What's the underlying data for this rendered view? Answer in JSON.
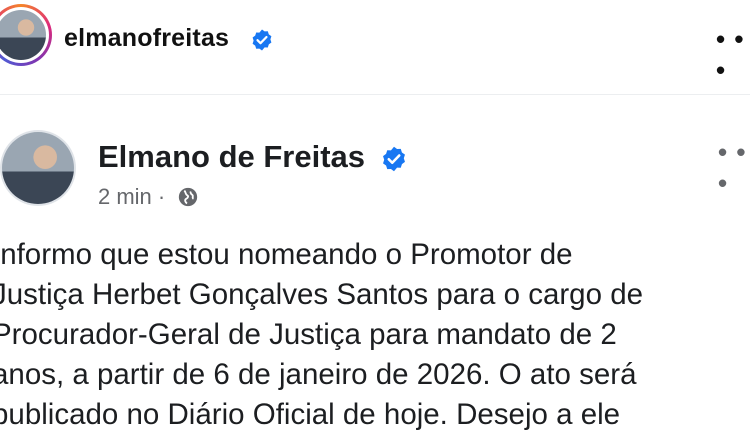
{
  "header": {
    "username": "elmanofreitas",
    "more_label": "• • •",
    "verified_icon": "verified-badge-icon",
    "ring_colors": [
      "#f58529",
      "#dd2a7b",
      "#8134af",
      "#515bd4"
    ]
  },
  "post": {
    "author": "Elmano de Freitas",
    "time": "2 min",
    "separator": "·",
    "audience_icon": "globe-icon",
    "more_label": "• • •",
    "text": "Informo que estou nomeando o Promotor de\nJustiça Herbet Gonçalves Santos para o cargo de\nProcurador-Geral de Justiça para mandato de 2\nanos, a partir de 6 de janeiro de 2026. O ato será\npublicado no Diário Oficial de hoje. Desejo a ele"
  },
  "colors": {
    "verified": "#1877f2",
    "meta_text": "#65676b"
  }
}
